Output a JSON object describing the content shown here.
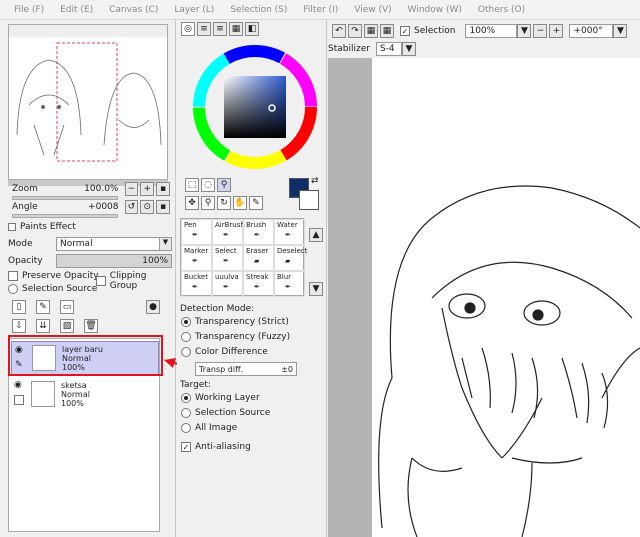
{
  "menu": [
    "File (F)",
    "Edit (E)",
    "Canvas (C)",
    "Layer (L)",
    "Selection (S)",
    "Filter (I)",
    "View (V)",
    "Window (W)",
    "Others (O)"
  ],
  "navigator": {
    "zoom_label": "Zoom",
    "zoom_value": "100.0%",
    "angle_label": "Angle",
    "angle_value": "+0008"
  },
  "paints_effect": "Paints Effect",
  "mode_label": "Mode",
  "mode_value": "Normal",
  "opacity_label": "Opacity",
  "opacity_value": "100%",
  "preserve_opacity": "Preserve Opacity",
  "clipping_group": "Clipping Group",
  "selection_source": "Selection Source",
  "layers": [
    {
      "name": "layer baru",
      "mode": "Normal",
      "opacity": "100%"
    },
    {
      "name": "sketsa",
      "mode": "Normal",
      "opacity": "100%"
    }
  ],
  "tools": [
    "Pen",
    "AirBrush",
    "Brush",
    "Water",
    "Marker",
    "Select",
    "Eraser",
    "Deselect",
    "Bucket",
    "uuulva",
    "Streak",
    "Blur"
  ],
  "detection": {
    "title": "Detection Mode:",
    "options": [
      "Transparency (Strict)",
      "Transparency (Fuzzy)",
      "Color Difference"
    ],
    "transp_label": "Transp diff.",
    "transp_value": "±0",
    "target_title": "Target:",
    "targets": [
      "Working Layer",
      "Selection Source",
      "All Image"
    ],
    "anti_aliasing": "Anti-aliasing"
  },
  "toolbar": {
    "selection_label": "Selection",
    "zoom_value": "100%",
    "angle_value": "+000°"
  },
  "stabilizer": {
    "label": "Stabilizer",
    "value": "S-4"
  },
  "colors": {
    "primary": "#0f2f6b",
    "highlight": "#cfcff5",
    "arrow": "#e0141a"
  }
}
